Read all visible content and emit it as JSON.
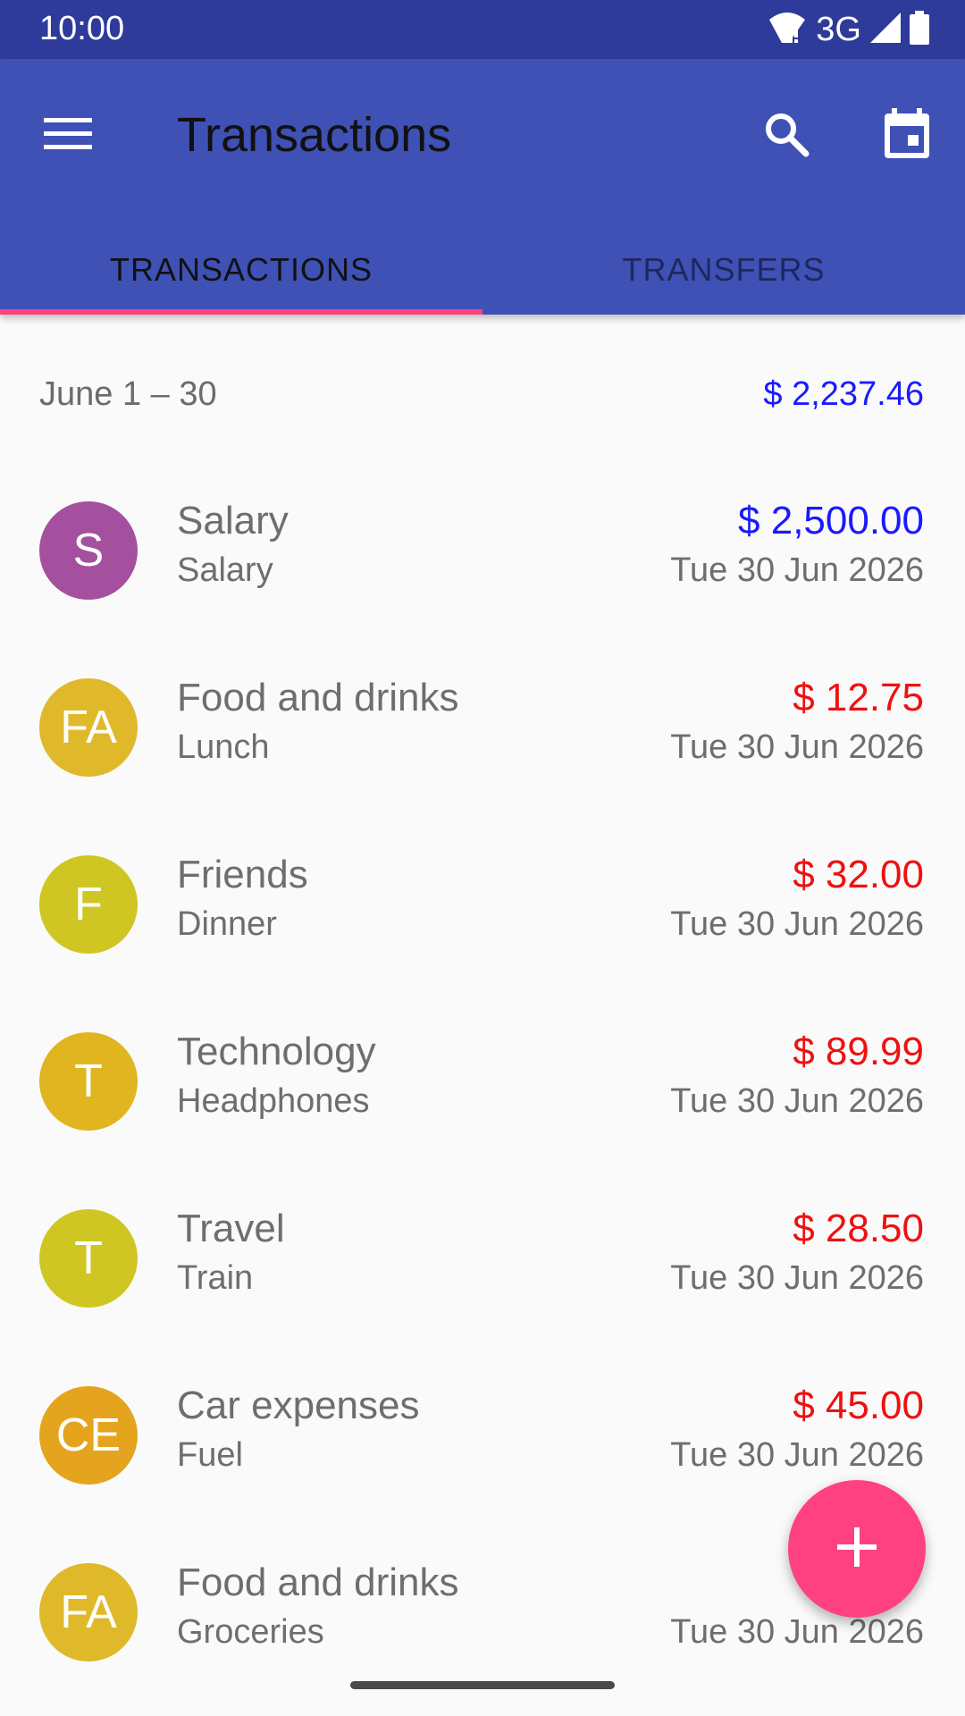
{
  "status_bar": {
    "time": "10:00",
    "network": "3G"
  },
  "app_bar": {
    "title": "Transactions"
  },
  "tabs": [
    {
      "label": "TRANSACTIONS",
      "selected": true
    },
    {
      "label": "TRANSFERS",
      "selected": false
    }
  ],
  "summary": {
    "range": "June 1 – 30",
    "total": "$ 2,237.46"
  },
  "transactions": [
    {
      "initials": "S",
      "avatar_color": "#a4509e",
      "title": "Salary",
      "subtitle": "Salary",
      "amount": "$ 2,500.00",
      "amount_color": "#1a1aff",
      "date": "Tue 30 Jun 2026"
    },
    {
      "initials": "FA",
      "avatar_color": "#e0b92a",
      "title": "Food and drinks",
      "subtitle": "Lunch",
      "amount": "$ 12.75",
      "amount_color": "#ee1111",
      "date": "Tue 30 Jun 2026"
    },
    {
      "initials": "F",
      "avatar_color": "#cfc624",
      "title": "Friends",
      "subtitle": "Dinner",
      "amount": "$ 32.00",
      "amount_color": "#ee1111",
      "date": "Tue 30 Jun 2026"
    },
    {
      "initials": "T",
      "avatar_color": "#e0b520",
      "title": "Technology",
      "subtitle": "Headphones",
      "amount": "$ 89.99",
      "amount_color": "#ee1111",
      "date": "Tue 30 Jun 2026"
    },
    {
      "initials": "T",
      "avatar_color": "#cfc624",
      "title": "Travel",
      "subtitle": "Train",
      "amount": "$ 28.50",
      "amount_color": "#ee1111",
      "date": "Tue 30 Jun 2026"
    },
    {
      "initials": "CE",
      "avatar_color": "#e4a41e",
      "title": "Car expenses",
      "subtitle": "Fuel",
      "amount": "$ 45.00",
      "amount_color": "#ee1111",
      "date": "Tue 30 Jun 2026"
    },
    {
      "initials": "FA",
      "avatar_color": "#e0b92a",
      "title": "Food and drinks",
      "subtitle": "Groceries",
      "amount": "",
      "amount_color": "#ee1111",
      "date": "Tue 30 Jun 2026"
    }
  ],
  "colors": {
    "primary": "#3f51b5",
    "primary_dark": "#2e3b9a",
    "accent": "#ff4081",
    "income": "#1a1aff",
    "expense": "#ee1111"
  },
  "icons": {
    "menu": "menu-icon",
    "search": "search-icon",
    "calendar": "calendar-icon",
    "add": "plus-icon"
  }
}
